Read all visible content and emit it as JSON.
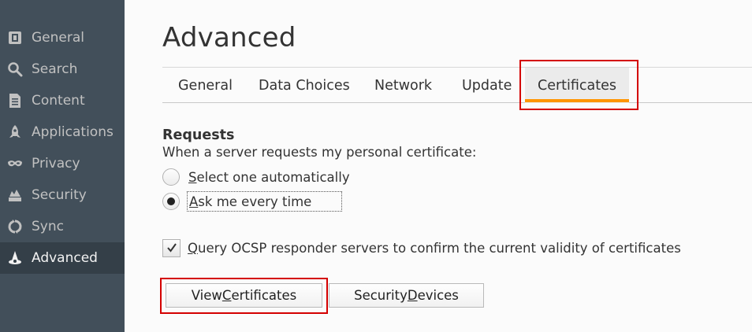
{
  "sidebar": {
    "items": [
      {
        "label": "General",
        "icon": "general-icon"
      },
      {
        "label": "Search",
        "icon": "search-icon"
      },
      {
        "label": "Content",
        "icon": "content-icon"
      },
      {
        "label": "Applications",
        "icon": "applications-icon"
      },
      {
        "label": "Privacy",
        "icon": "privacy-mask-icon"
      },
      {
        "label": "Security",
        "icon": "security-icon"
      },
      {
        "label": "Sync",
        "icon": "sync-icon"
      },
      {
        "label": "Advanced",
        "icon": "advanced-icon",
        "active": true
      }
    ]
  },
  "page": {
    "title": "Advanced"
  },
  "tabs": [
    {
      "label": "General"
    },
    {
      "label": "Data Choices"
    },
    {
      "label": "Network"
    },
    {
      "label": "Update"
    },
    {
      "label": "Certificates",
      "selected": true
    }
  ],
  "requests": {
    "title": "Requests",
    "description": "When a server requests my personal certificate:",
    "options": [
      {
        "label_access": "S",
        "label_rest": "elect one automatically",
        "checked": false
      },
      {
        "label_access": "A",
        "label_rest": "sk me every time",
        "checked": true
      }
    ]
  },
  "ocsp": {
    "label_access": "Q",
    "label_rest": "uery OCSP responder servers to confirm the current validity of certificates",
    "checked": true
  },
  "buttons": {
    "view_certificates": {
      "before": "View ",
      "access": "C",
      "after": "ertificates"
    },
    "security_devices": {
      "before": "Security ",
      "access": "D",
      "after": "evices"
    }
  },
  "colors": {
    "sidebar_bg": "#424f5a",
    "sidebar_active_bg": "#343f48",
    "tab_underline": "#ff9500",
    "highlight": "#d40000"
  }
}
